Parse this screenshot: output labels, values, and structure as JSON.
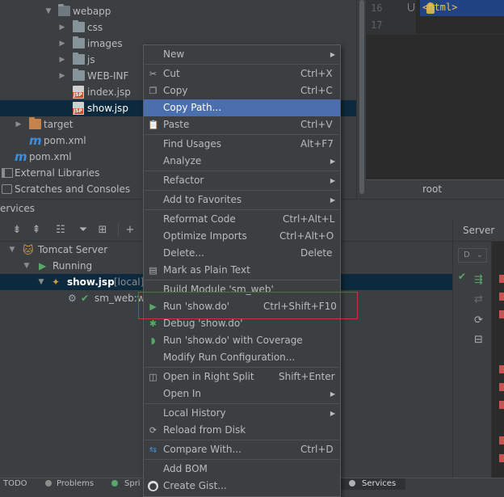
{
  "project_tree": {
    "rows": [
      {
        "label": "webapp",
        "kind": "folder"
      },
      {
        "label": "css",
        "kind": "folder"
      },
      {
        "label": "images",
        "kind": "folder"
      },
      {
        "label": "js",
        "kind": "folder"
      },
      {
        "label": "WEB-INF",
        "kind": "folder"
      },
      {
        "label": "index.jsp",
        "kind": "jsp"
      },
      {
        "label": "show.jsp",
        "kind": "jsp"
      },
      {
        "label": "target",
        "kind": "folder-orange"
      },
      {
        "label": "pom.xml",
        "kind": "maven"
      },
      {
        "label": "pom.xml",
        "kind": "maven"
      },
      {
        "label": "External Libraries",
        "kind": "libraries"
      },
      {
        "label": "Scratches and Consoles",
        "kind": "scratches"
      }
    ]
  },
  "editor": {
    "line_numbers": [
      "16",
      "17"
    ],
    "code_line": "<html>",
    "breadcrumb": "root"
  },
  "services": {
    "title": "ervices",
    "tree": {
      "tomcat": "Tomcat Server",
      "running": "Running",
      "artifact": "show.jsp",
      "artifact_suffix": "[local]",
      "deployment": "sm_web:wa"
    },
    "right_tab": "Server",
    "right_dropdown": "D"
  },
  "status_bar": {
    "items": [
      "TODO",
      "Problems",
      "Spri",
      "Create Gist",
      "Services"
    ]
  },
  "context_menu": {
    "items": [
      {
        "label": "New",
        "shortcut": "",
        "submenu": true
      },
      {
        "label": "Cut",
        "shortcut": "Ctrl+X",
        "icon": "cut-icon"
      },
      {
        "label": "Copy",
        "shortcut": "Ctrl+C",
        "icon": "copy-icon"
      },
      {
        "label": "Copy Path...",
        "shortcut": "",
        "highlight": true
      },
      {
        "label": "Paste",
        "shortcut": "Ctrl+V",
        "icon": "paste-icon"
      },
      {
        "label": "Find Usages",
        "shortcut": "Alt+F7"
      },
      {
        "label": "Analyze",
        "shortcut": "",
        "submenu": true
      },
      {
        "label": "Refactor",
        "shortcut": "",
        "submenu": true
      },
      {
        "label": "Add to Favorites",
        "shortcut": "",
        "submenu": true
      },
      {
        "label": "Reformat Code",
        "shortcut": "Ctrl+Alt+L"
      },
      {
        "label": "Optimize Imports",
        "shortcut": "Ctrl+Alt+O"
      },
      {
        "label": "Delete...",
        "shortcut": "Delete"
      },
      {
        "label": "Mark as Plain Text",
        "shortcut": "",
        "icon": "plain-text-icon"
      },
      {
        "label": "Build Module 'sm_web'",
        "shortcut": ""
      },
      {
        "label": "Run 'show.do'",
        "shortcut": "Ctrl+Shift+F10",
        "icon": "run-icon"
      },
      {
        "label": "Debug 'show.do'",
        "shortcut": "",
        "icon": "debug-icon"
      },
      {
        "label": "Run 'show.do' with Coverage",
        "shortcut": "",
        "icon": "coverage-icon"
      },
      {
        "label": "Modify Run Configuration...",
        "shortcut": ""
      },
      {
        "label": "Open in Right Split",
        "shortcut": "Shift+Enter",
        "icon": "split-icon"
      },
      {
        "label": "Open In",
        "shortcut": "",
        "submenu": true
      },
      {
        "label": "Local History",
        "shortcut": "",
        "submenu": true
      },
      {
        "label": "Reload from Disk",
        "shortcut": "",
        "icon": "reload-icon"
      },
      {
        "label": "Compare With...",
        "shortcut": "Ctrl+D",
        "icon": "compare-icon"
      },
      {
        "label": "Add BOM",
        "shortcut": ""
      },
      {
        "label": "Create Gist...",
        "shortcut": "",
        "icon": "github-icon"
      }
    ]
  }
}
